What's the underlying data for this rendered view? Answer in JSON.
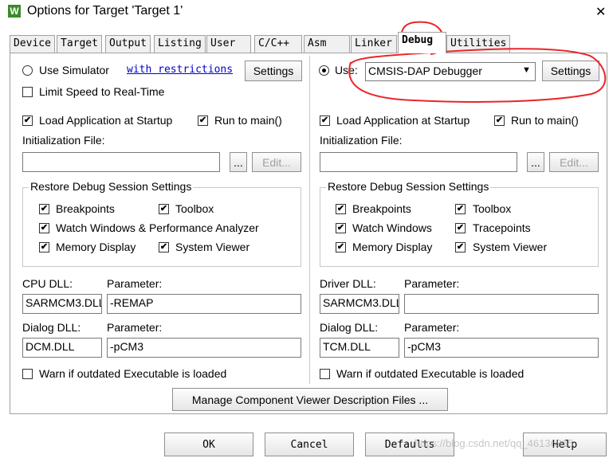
{
  "window": {
    "title": "Options for Target 'Target 1'",
    "close": "✕",
    "logo": "W"
  },
  "tabs": [
    "Device",
    "Target",
    "Output",
    "Listing",
    "User",
    "C/C++",
    "Asm",
    "Linker",
    "Debug",
    "Utilities"
  ],
  "active_tab": "Debug",
  "left": {
    "use_simulator": "Use Simulator",
    "with_restrictions": "with restrictions",
    "settings": "Settings",
    "limit_speed": "Limit Speed to Real-Time",
    "load_app": "Load Application at Startup",
    "run_to_main": "Run to main()",
    "init_file_label": "Initialization File:",
    "init_file_value": "",
    "browse": "...",
    "edit": "Edit...",
    "restore_group": "Restore Debug Session Settings",
    "breakpoints": "Breakpoints",
    "toolbox": "Toolbox",
    "watch_windows": "Watch Windows & Performance Analyzer",
    "memory_display": "Memory Display",
    "system_viewer": "System Viewer",
    "cpu_dll_label": "CPU DLL:",
    "parameter_label": "Parameter:",
    "cpu_dll": "SARMCM3.DLL",
    "cpu_param": "-REMAP",
    "dialog_dll_label": "Dialog DLL:",
    "dialog_dll": "DCM.DLL",
    "dialog_param": "-pCM3",
    "warn": "Warn if outdated Executable is loaded"
  },
  "right": {
    "use": "Use:",
    "debugger": "CMSIS-DAP Debugger",
    "settings": "Settings",
    "load_app": "Load Application at Startup",
    "run_to_main": "Run to main()",
    "init_file_label": "Initialization File:",
    "init_file_value": "",
    "browse": "...",
    "edit": "Edit...",
    "restore_group": "Restore Debug Session Settings",
    "breakpoints": "Breakpoints",
    "toolbox": "Toolbox",
    "watch_windows": "Watch Windows",
    "tracepoints": "Tracepoints",
    "memory_display": "Memory Display",
    "system_viewer": "System Viewer",
    "driver_dll_label": "Driver DLL:",
    "parameter_label": "Parameter:",
    "driver_dll": "SARMCM3.DLL",
    "driver_param": "",
    "dialog_dll_label": "Dialog DLL:",
    "dialog_dll": "TCM.DLL",
    "dialog_param": "-pCM3",
    "warn": "Warn if outdated Executable is loaded"
  },
  "manage_button": "Manage Component Viewer Description Files ...",
  "footer": {
    "ok": "OK",
    "cancel": "Cancel",
    "defaults": "Defaults",
    "help": "Help",
    "watermark": "https://blog.csdn.net/qq_46136915"
  },
  "colors": {
    "annotation": "#e8262a",
    "logo_bg": "#3a8a2a",
    "link": "#0000cc"
  },
  "checked": "✔",
  "dropdown_arrow": "▼"
}
